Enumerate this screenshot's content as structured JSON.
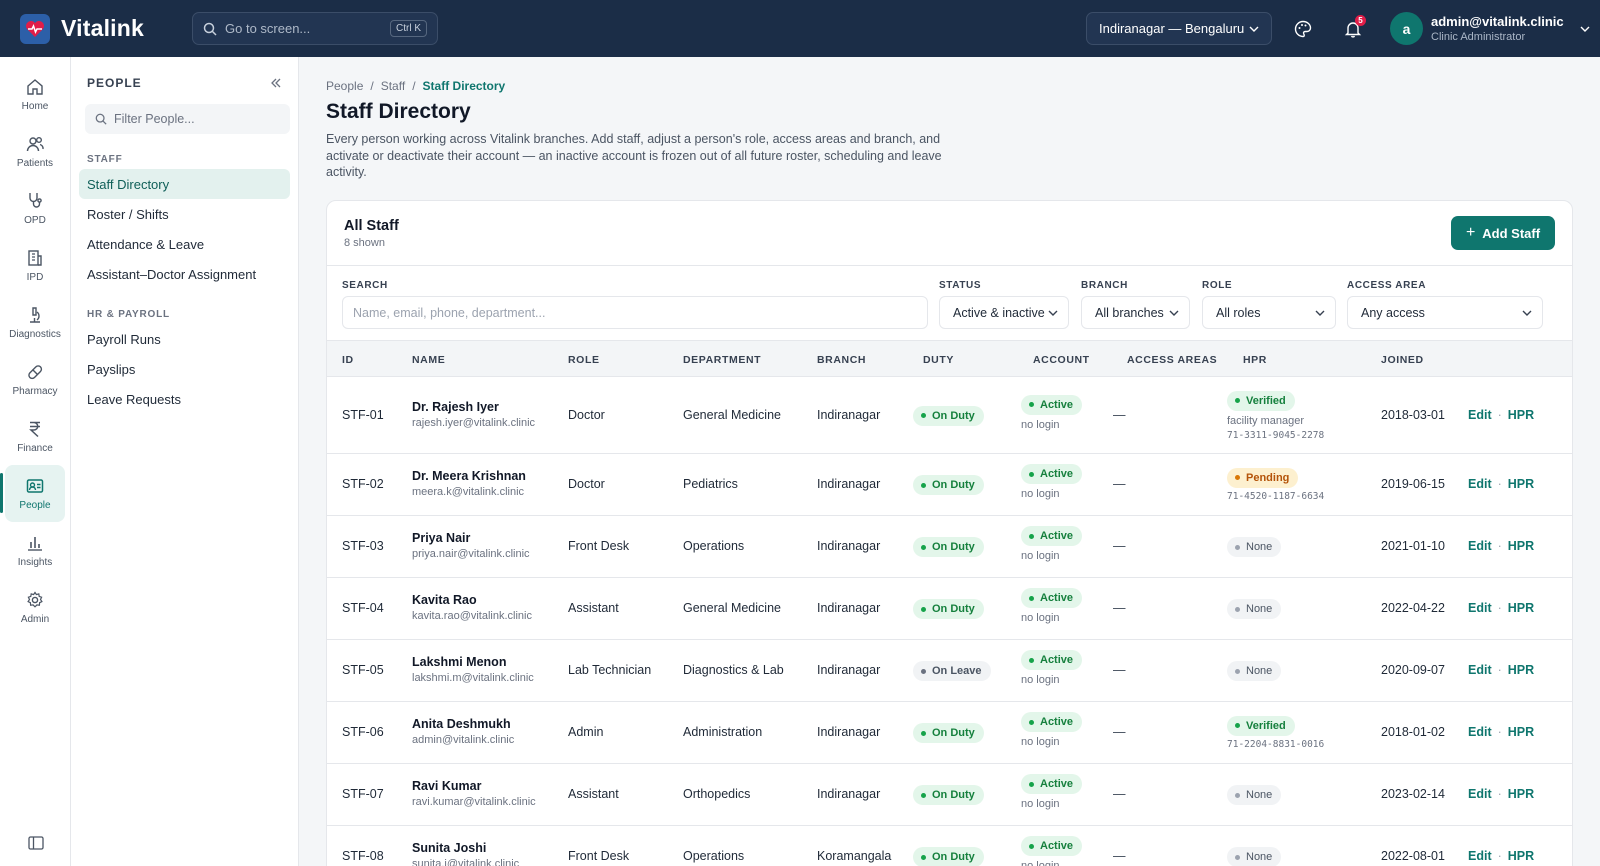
{
  "topbar": {
    "brand": "Vitalink",
    "search_placeholder": "Go to screen...",
    "search_shortcut": "Ctrl K",
    "branch": "Indiranagar — Bengaluru",
    "notifications_count": "5",
    "user": {
      "initial": "a",
      "email": "admin@vitalink.clinic",
      "role": "Clinic Administrator"
    }
  },
  "rail": [
    {
      "label": "Home",
      "icon": "home-icon"
    },
    {
      "label": "Patients",
      "icon": "users-icon"
    },
    {
      "label": "OPD",
      "icon": "stethoscope-icon"
    },
    {
      "label": "IPD",
      "icon": "building-icon"
    },
    {
      "label": "Diagnostics",
      "icon": "microscope-icon"
    },
    {
      "label": "Pharmacy",
      "icon": "pill-icon"
    },
    {
      "label": "Finance",
      "icon": "rupee-icon"
    },
    {
      "label": "People",
      "icon": "id-card-icon"
    },
    {
      "label": "Insights",
      "icon": "bar-chart-icon"
    },
    {
      "label": "Admin",
      "icon": "gear-icon"
    }
  ],
  "subnav": {
    "title": "PEOPLE",
    "filter_placeholder": "Filter People...",
    "groups": [
      {
        "label": "STAFF",
        "items": [
          "Staff Directory",
          "Roster / Shifts",
          "Attendance & Leave",
          "Assistant–Doctor Assignment"
        ]
      },
      {
        "label": "HR & PAYROLL",
        "items": [
          "Payroll Runs",
          "Payslips",
          "Leave Requests"
        ]
      }
    ]
  },
  "breadcrumb": [
    "People",
    "Staff",
    "Staff Directory"
  ],
  "page": {
    "title": "Staff Directory",
    "description": "Every person working across Vitalink branches. Add staff, adjust a person's role, access areas and branch, and activate or deactivate their account — an inactive account is frozen out of all future roster, scheduling and leave activity."
  },
  "card": {
    "title": "All Staff",
    "subtitle": "8 shown",
    "add_button": "Add Staff"
  },
  "filters": {
    "search_label": "SEARCH",
    "search_placeholder": "Name, email, phone, department...",
    "status_label": "STATUS",
    "status_value": "Active & inactive",
    "branch_label": "BRANCH",
    "branch_value": "All branches",
    "role_label": "ROLE",
    "role_value": "All roles",
    "access_label": "ACCESS AREA",
    "access_value": "Any access"
  },
  "columns": [
    "ID",
    "NAME",
    "ROLE",
    "DEPARTMENT",
    "BRANCH",
    "DUTY",
    "ACCOUNT",
    "ACCESS AREAS",
    "HPR",
    "JOINED"
  ],
  "rows": [
    {
      "id": "STF-01",
      "name": "Dr. Rajesh Iyer",
      "email": "rajesh.iyer@vitalink.clinic",
      "role": "Doctor",
      "department": "General Medicine",
      "branch": "Indiranagar",
      "duty": "On Duty",
      "account": "Active",
      "account_note": "no login",
      "access": "—",
      "hpr": "Verified",
      "hpr_note": "facility manager",
      "hpr_id": "71-3311-9045-2278",
      "joined": "2018-03-01",
      "edit": "Edit",
      "hpr_link": "HPR"
    },
    {
      "id": "STF-02",
      "name": "Dr. Meera Krishnan",
      "email": "meera.k@vitalink.clinic",
      "role": "Doctor",
      "department": "Pediatrics",
      "branch": "Indiranagar",
      "duty": "On Duty",
      "account": "Active",
      "account_note": "no login",
      "access": "—",
      "hpr": "Pending",
      "hpr_note": "",
      "hpr_id": "71-4520-1187-6634",
      "joined": "2019-06-15",
      "edit": "Edit",
      "hpr_link": "HPR"
    },
    {
      "id": "STF-03",
      "name": "Priya Nair",
      "email": "priya.nair@vitalink.clinic",
      "role": "Front Desk",
      "department": "Operations",
      "branch": "Indiranagar",
      "duty": "On Duty",
      "account": "Active",
      "account_note": "no login",
      "access": "—",
      "hpr": "None",
      "hpr_note": "",
      "hpr_id": "",
      "joined": "2021-01-10",
      "edit": "Edit",
      "hpr_link": "HPR"
    },
    {
      "id": "STF-04",
      "name": "Kavita Rao",
      "email": "kavita.rao@vitalink.clinic",
      "role": "Assistant",
      "department": "General Medicine",
      "branch": "Indiranagar",
      "duty": "On Duty",
      "account": "Active",
      "account_note": "no login",
      "access": "—",
      "hpr": "None",
      "hpr_note": "",
      "hpr_id": "",
      "joined": "2022-04-22",
      "edit": "Edit",
      "hpr_link": "HPR"
    },
    {
      "id": "STF-05",
      "name": "Lakshmi Menon",
      "email": "lakshmi.m@vitalink.clinic",
      "role": "Lab Technician",
      "department": "Diagnostics & Lab",
      "branch": "Indiranagar",
      "duty": "On Leave",
      "account": "Active",
      "account_note": "no login",
      "access": "—",
      "hpr": "None",
      "hpr_note": "",
      "hpr_id": "",
      "joined": "2020-09-07",
      "edit": "Edit",
      "hpr_link": "HPR"
    },
    {
      "id": "STF-06",
      "name": "Anita Deshmukh",
      "email": "admin@vitalink.clinic",
      "role": "Admin",
      "department": "Administration",
      "branch": "Indiranagar",
      "duty": "On Duty",
      "account": "Active",
      "account_note": "no login",
      "access": "—",
      "hpr": "Verified",
      "hpr_note": "",
      "hpr_id": "71-2204-8831-0016",
      "joined": "2018-01-02",
      "edit": "Edit",
      "hpr_link": "HPR"
    },
    {
      "id": "STF-07",
      "name": "Ravi Kumar",
      "email": "ravi.kumar@vitalink.clinic",
      "role": "Assistant",
      "department": "Orthopedics",
      "branch": "Indiranagar",
      "duty": "On Duty",
      "account": "Active",
      "account_note": "no login",
      "access": "—",
      "hpr": "None",
      "hpr_note": "",
      "hpr_id": "",
      "joined": "2023-02-14",
      "edit": "Edit",
      "hpr_link": "HPR"
    },
    {
      "id": "STF-08",
      "name": "Sunita Joshi",
      "email": "sunita.j@vitalink.clinic",
      "role": "Front Desk",
      "department": "Operations",
      "branch": "Koramangala",
      "duty": "On Duty",
      "account": "Active",
      "account_note": "no login",
      "access": "—",
      "hpr": "None",
      "hpr_note": "",
      "hpr_id": "",
      "joined": "2022-08-01",
      "edit": "Edit",
      "hpr_link": "HPR"
    }
  ]
}
